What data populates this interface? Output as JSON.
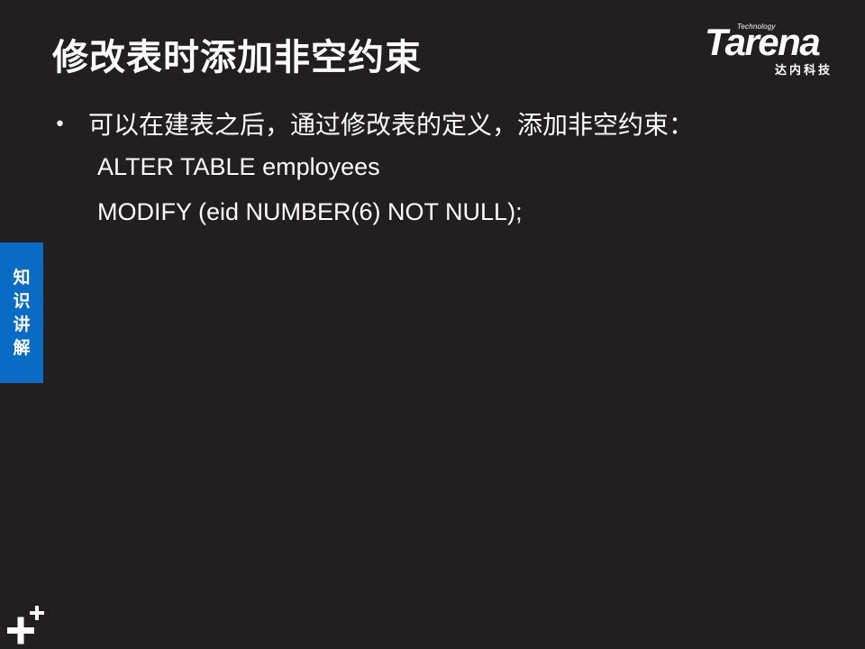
{
  "slide": {
    "title": "修改表时添加非空约束",
    "bullet": "可以在建表之后，通过修改表的定义，添加非空约束：",
    "bullet_marker": "•",
    "code_lines": [
      "ALTER TABLE employees",
      "MODIFY (eid NUMBER(6) NOT NULL);"
    ]
  },
  "logo": {
    "tech": "Technology",
    "word": "Tarena",
    "sub": "达内科技"
  },
  "side_tab": {
    "chars": [
      "知",
      "识",
      "讲",
      "解"
    ]
  },
  "colors": {
    "background": "#231f20",
    "accent_tab": "#0a6bc4",
    "text": "#ffffff"
  },
  "icons": {
    "bottom_left": "plus-plus-icon"
  }
}
